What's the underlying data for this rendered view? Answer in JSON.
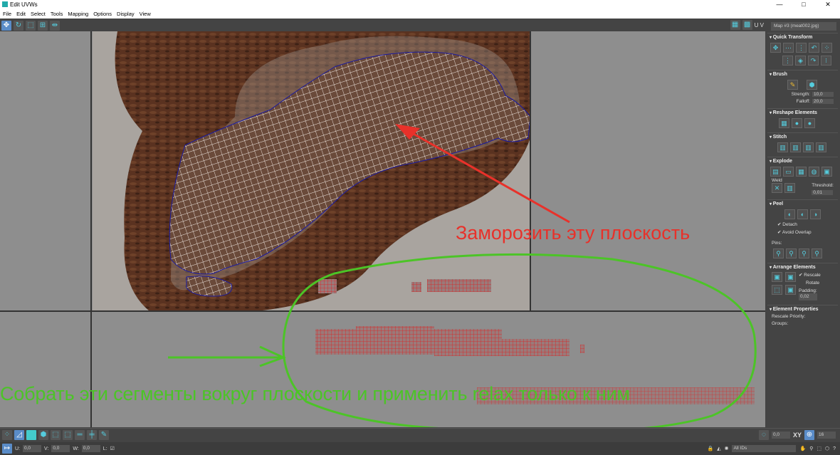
{
  "window": {
    "title": "Edit UVWs",
    "controls": [
      "—",
      "□",
      "✕"
    ]
  },
  "menu": [
    "File",
    "Edit",
    "Select",
    "Tools",
    "Mapping",
    "Options",
    "Display",
    "View"
  ],
  "toolbar": {
    "uv_label": "U V",
    "map_dropdown": "Map #3 (meat002.jpg)"
  },
  "panel": {
    "quick_transform": "Quick Transform",
    "brush": {
      "title": "Brush",
      "strength_label": "Strength:",
      "strength": "10,0",
      "falloff_label": "Falloff:",
      "falloff": "20,0"
    },
    "reshape": "Reshape Elements",
    "stitch": "Stitch",
    "explode": {
      "title": "Explode",
      "weld": "Weld",
      "threshold_label": "Threshold:",
      "threshold": "0,01"
    },
    "peel": {
      "title": "Peel",
      "detach": "Detach",
      "avoid_overlap": "Avoid Overlap",
      "pins": "Pins:"
    },
    "arrange": {
      "title": "Arrange Elements",
      "rescale": "Rescale",
      "rotate": "Rotate",
      "padding_label": "Padding:",
      "padding": "0,02"
    },
    "element_properties": {
      "title": "Element Properties",
      "rescale_priority": "Rescale Priority:",
      "groups": "Groups:"
    }
  },
  "annotations": {
    "red": "Заморозить эту плоскость",
    "green": "Собрать эти сегменты вокруг плоскости и применить relax только к ним",
    "colors": {
      "red": "#e8312a",
      "green": "#4cc427"
    }
  },
  "bottom": {
    "u_label": "U:",
    "u": "0,0",
    "v_label": "V:",
    "v": "0,0",
    "w_label": "W:",
    "w": "0,0",
    "l_label": "L:",
    "rotate_value": "0,0",
    "xy": "XY",
    "grid_value": "16",
    "ids": "All IDs"
  }
}
